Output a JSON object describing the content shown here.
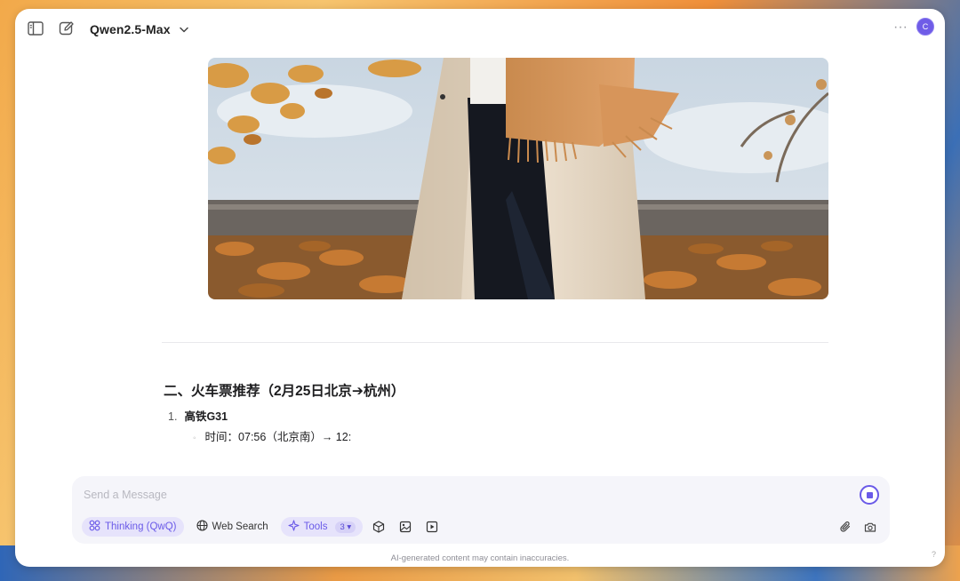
{
  "header": {
    "model_name": "Qwen2.5-Max",
    "more_label": "···",
    "avatar_initial": "C",
    "icons": [
      "sidebar-toggle-icon",
      "new-chat-icon",
      "chevron-down-icon"
    ]
  },
  "content": {
    "image_subject": "person-in-coat-and-scarf-autumn-photo",
    "section_heading": "二、火车票推荐（2月25日北京➔杭州）",
    "list": [
      {
        "number": "1.",
        "title": "高铁G31",
        "details": [
          {
            "bullet": "◦",
            "text": "时间：07:56（北京南）→ 12:"
          }
        ]
      }
    ]
  },
  "composer": {
    "placeholder": "Send a Message",
    "tools": {
      "thinking_label": "Thinking (QwQ)",
      "web_search_label": "Web Search",
      "tools_label": "Tools",
      "tools_count": "3 ▾"
    }
  },
  "footer": {
    "disclaimer": "AI-generated content may contain inaccuracies.",
    "help": "?"
  },
  "colors": {
    "accent": "#6a5ae8",
    "accent_soft": "#e6e3fb",
    "composer_bg": "#f5f5fa",
    "text": "#1d1d1f"
  }
}
